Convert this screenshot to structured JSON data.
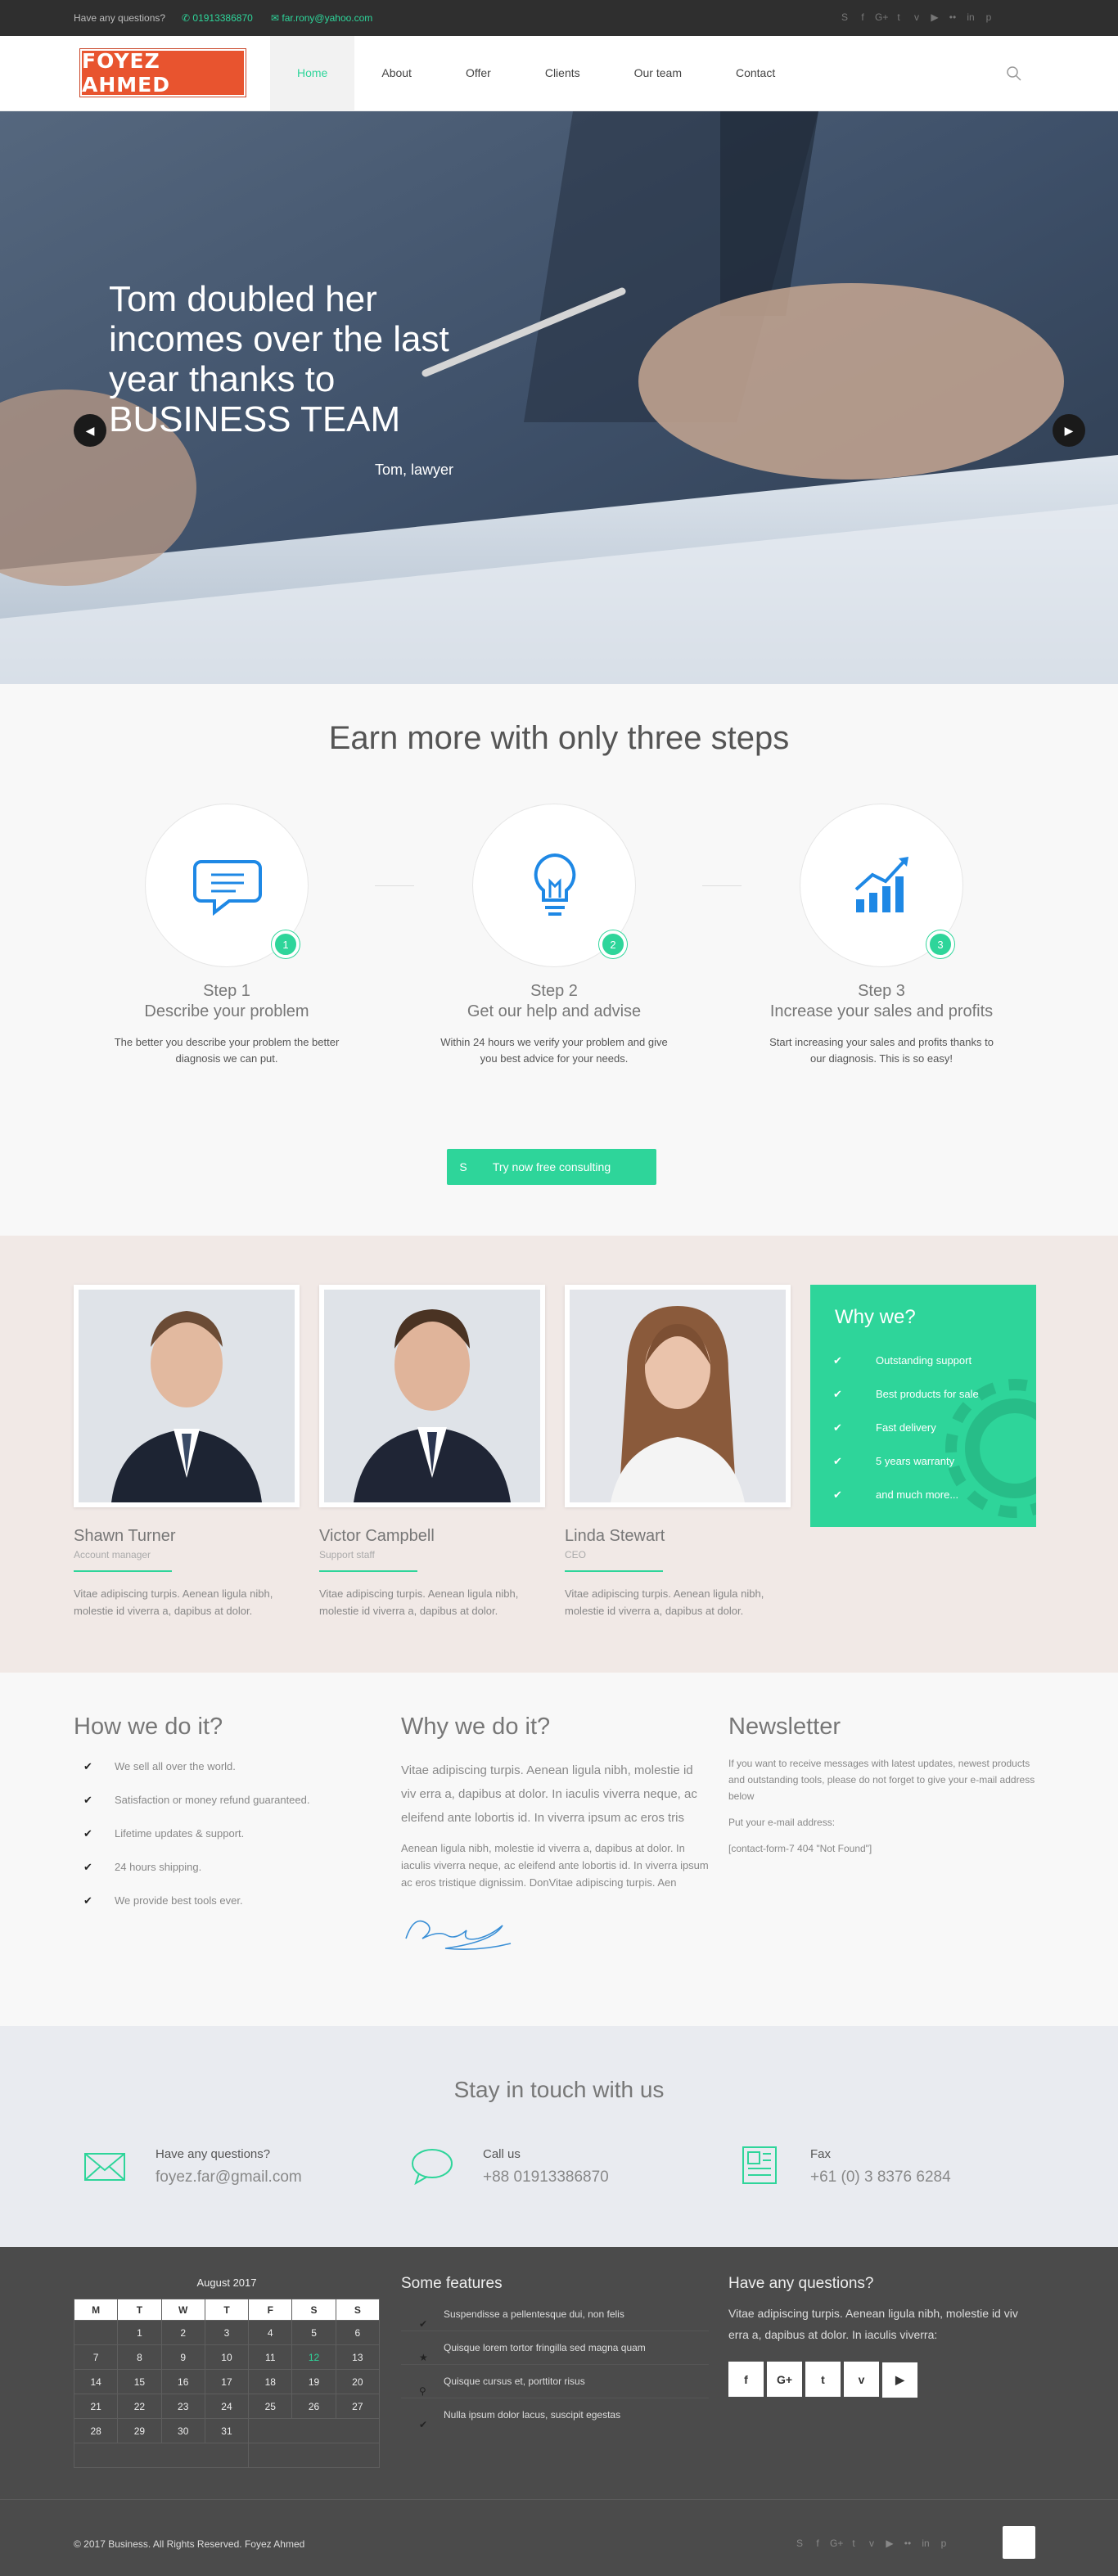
{
  "topbar": {
    "question": "Have any questions?",
    "phone": "01913386870",
    "email": "far.rony@yahoo.com",
    "socials": [
      "skype-icon",
      "facebook-icon",
      "google-plus-icon",
      "twitter-icon",
      "vimeo-icon",
      "youtube-icon",
      "flickr-icon",
      "linkedin-icon",
      "pinterest-icon"
    ]
  },
  "header": {
    "logo": "FOYEZ AHMED",
    "nav": [
      "Home",
      "About",
      "Offer",
      "Clients",
      "Our team",
      "Contact"
    ],
    "active": "Home"
  },
  "hero": {
    "title": "Tom doubled her incomes over the last year thanks to BUSINESS TEAM",
    "author": "Tom, lawyer"
  },
  "steps": {
    "title": "Earn more with only three steps",
    "items": [
      {
        "num": "1",
        "step": "Step 1",
        "name": "Describe your problem",
        "desc": "The better you describe your problem the better diagnosis we can put.",
        "icon": "chat-icon"
      },
      {
        "num": "2",
        "step": "Step 2",
        "name": "Get our help and advise",
        "desc": "Within 24 hours we verify your problem and give you best advice for your needs.",
        "icon": "lightbulb-icon"
      },
      {
        "num": "3",
        "step": "Step 3",
        "name": "Increase your sales and profits",
        "desc": "Start increasing your sales and profits thanks to our diagnosis. This is so easy!",
        "icon": "growth-chart-icon"
      }
    ],
    "cta": "Try now free consulting"
  },
  "team": {
    "members": [
      {
        "name": "Shawn Turner",
        "role": "Account manager",
        "desc": "Vitae adipiscing turpis. Aenean ligula nibh, molestie id viverra a, dapibus at dolor."
      },
      {
        "name": "Victor Campbell",
        "role": "Support staff",
        "desc": "Vitae adipiscing turpis. Aenean ligula nibh, molestie id viverra a, dapibus at dolor."
      },
      {
        "name": "Linda Stewart",
        "role": "CEO",
        "desc": "Vitae adipiscing turpis. Aenean ligula nibh, molestie id viverra a, dapibus at dolor."
      }
    ],
    "why": {
      "title": "Why we?",
      "items": [
        "Outstanding support",
        "Best products for sale",
        "Fast delivery",
        "5 years warranty",
        "and much more..."
      ]
    }
  },
  "how": {
    "title": "How we do it?",
    "items": [
      "We sell all over the world.",
      "Satisfaction or money refund guaranteed.",
      "Lifetime updates & support.",
      "24 hours shipping.",
      "We provide best tools ever."
    ]
  },
  "whydo": {
    "title": "Why we do it?",
    "lead": "Vitae adipiscing turpis. Aenean ligula nibh, molestie id viv erra a, dapibus at dolor. In iaculis viverra neque, ac eleifend ante lobortis id. In viverra ipsum ac eros tris",
    "body": "Aenean ligula nibh, molestie id viverra a, dapibus at dolor. In iaculis viverra neque, ac eleifend ante lobortis id. In viverra ipsum ac eros tristique dignissim. DonVitae adipiscing turpis. Aen"
  },
  "newsletter": {
    "title": "Newsletter",
    "text": "If you want to receive messages with latest updates, newest products and outstanding tools, please do not forget to give your e-mail address below",
    "label": "Put your e-mail address:",
    "form": "[contact-form-7 404 \"Not Found\"]"
  },
  "touch": {
    "title": "Stay in touch with us",
    "items": [
      {
        "label": "Have any questions?",
        "value": "foyez.far@gmail.com",
        "icon": "envelope-icon"
      },
      {
        "label": "Call us",
        "value": "+88 01913386870",
        "icon": "speech-bubble-icon"
      },
      {
        "label": "Fax",
        "value": "+61 (0) 3 8376 6284",
        "icon": "fax-document-icon"
      }
    ]
  },
  "calendar": {
    "title": "August 2017",
    "days": [
      "M",
      "T",
      "W",
      "T",
      "F",
      "S",
      "S"
    ],
    "rows": [
      [
        "",
        "1",
        "2",
        "3",
        "4",
        "5",
        "6"
      ],
      [
        "7",
        "8",
        "9",
        "10",
        "11",
        "12",
        "13"
      ],
      [
        "14",
        "15",
        "16",
        "17",
        "18",
        "19",
        "20"
      ],
      [
        "21",
        "22",
        "23",
        "24",
        "25",
        "26",
        "27"
      ],
      [
        "28",
        "29",
        "30",
        "31",
        "",
        "",
        ""
      ],
      [
        "",
        "",
        "",
        "",
        "",
        "",
        ""
      ]
    ],
    "highlight": "12"
  },
  "features": {
    "title": "Some features",
    "items": [
      {
        "text": "Suspendisse a pellentesque dui, non felis",
        "icon": "check-icon"
      },
      {
        "text": "Quisque lorem tortor fringilla sed magna quam",
        "icon": "star-icon"
      },
      {
        "text": "Quisque cursus et, porttitor risus",
        "icon": "map-pin-icon"
      },
      {
        "text": "Nulla ipsum dolor lacus, suscipit egestas",
        "icon": "check-icon"
      }
    ]
  },
  "footerq": {
    "title": "Have any questions?",
    "text": "Vitae adipiscing turpis. Aenean ligula nibh, molestie id viv erra a, dapibus at dolor. In iaculis viverra:",
    "buttons": [
      "f",
      "G+",
      "t",
      "v",
      "▶"
    ]
  },
  "bottom": {
    "copyright": "© 2017 Business. All Rights Reserved. Foyez Ahmed"
  },
  "colors": {
    "accent": "#2ed59a",
    "logo": "#e8542f",
    "dark": "#2f2f2f",
    "footer": "#4b4b4b"
  }
}
